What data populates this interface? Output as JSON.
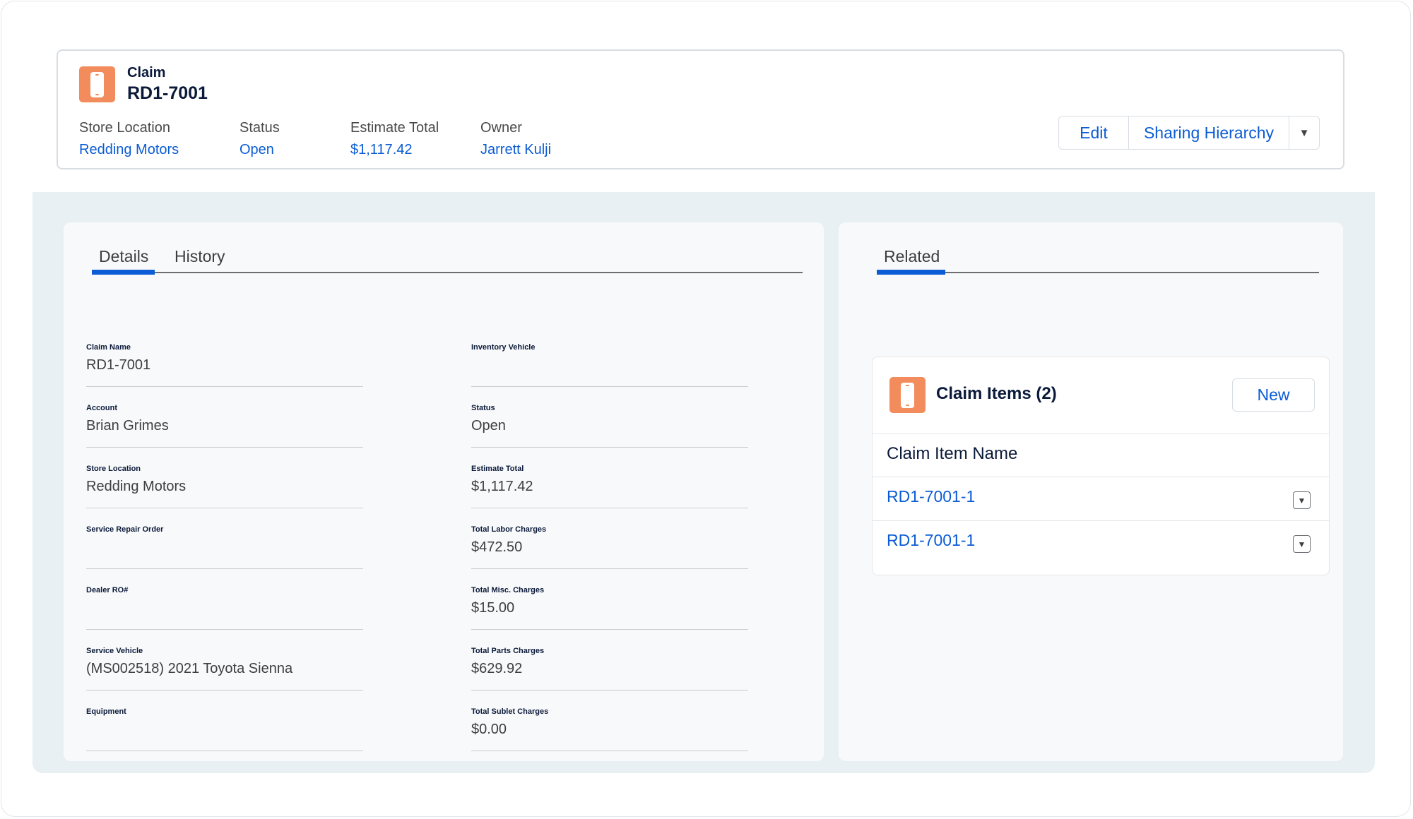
{
  "header": {
    "object_type": "Claim",
    "record_name": "RD1-7001",
    "icon": "phone-icon",
    "highlights": [
      {
        "label": "Store Location",
        "value": "Redding Motors"
      },
      {
        "label": "Status",
        "value": "Open"
      },
      {
        "label": "Estimate Total",
        "value": "$1,117.42"
      },
      {
        "label": "Owner",
        "value": "Jarrett Kulji"
      }
    ],
    "actions": {
      "edit": "Edit",
      "sharing": "Sharing Hierarchy",
      "more": "▼"
    }
  },
  "details_panel": {
    "tabs": [
      "Details",
      "History"
    ],
    "active_tab": "Details",
    "left_fields": [
      {
        "label": "Claim Name",
        "value": "RD1-7001"
      },
      {
        "label": "Account",
        "value": "Brian Grimes"
      },
      {
        "label": "Store Location",
        "value": "Redding Motors"
      },
      {
        "label": "Service Repair Order",
        "value": ""
      },
      {
        "label": "Dealer RO#",
        "value": ""
      },
      {
        "label": "Service Vehicle",
        "value": "(MS002518) 2021 Toyota Sienna"
      },
      {
        "label": "Equipment",
        "value": ""
      }
    ],
    "right_fields": [
      {
        "label": "Inventory Vehicle",
        "value": ""
      },
      {
        "label": "Status",
        "value": "Open"
      },
      {
        "label": "Estimate Total",
        "value": "$1,117.42"
      },
      {
        "label": "Total Labor Charges",
        "value": "$472.50"
      },
      {
        "label": "Total Misc. Charges",
        "value": "$15.00"
      },
      {
        "label": "Total Parts Charges",
        "value": "$629.92"
      },
      {
        "label": "Total Sublet Charges",
        "value": "$0.00"
      }
    ]
  },
  "related_panel": {
    "tabs": [
      "Related"
    ],
    "related_list": {
      "title": "Claim Items (2)",
      "icon": "phone-icon",
      "new_button": "New",
      "column_header": "Claim Item Name",
      "rows": [
        "RD1-7001-1",
        "RD1-7001-1"
      ],
      "row_menu": "▼"
    }
  },
  "colors": {
    "accent": "#0b5cd5",
    "icon_bg": "#f38c5c",
    "body_bg": "#e9f0f3",
    "heading": "#0b1a3a"
  }
}
